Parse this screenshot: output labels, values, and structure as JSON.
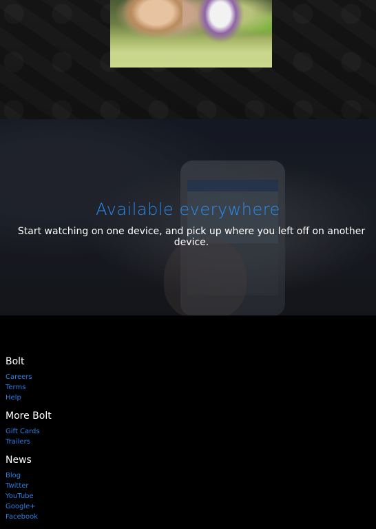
{
  "hero": {
    "image_alt": "Toy Story characters"
  },
  "available": {
    "title": "Available everywhere",
    "subtitle": "Start watching on one device, and pick up where you left off on another device."
  },
  "footer": {
    "groups": [
      {
        "heading": "Bolt",
        "links": [
          "Careers",
          "Terms",
          "Help"
        ]
      },
      {
        "heading": "More Bolt",
        "links": [
          "Gift Cards",
          "Trailers"
        ]
      },
      {
        "heading": "News",
        "links": [
          "Blog",
          "Twitter",
          "YouTube",
          "Google+",
          "Facebook"
        ]
      }
    ]
  },
  "colors": {
    "accent": "#2a8cf0",
    "link": "#2a7fe6",
    "background": "#000000"
  }
}
